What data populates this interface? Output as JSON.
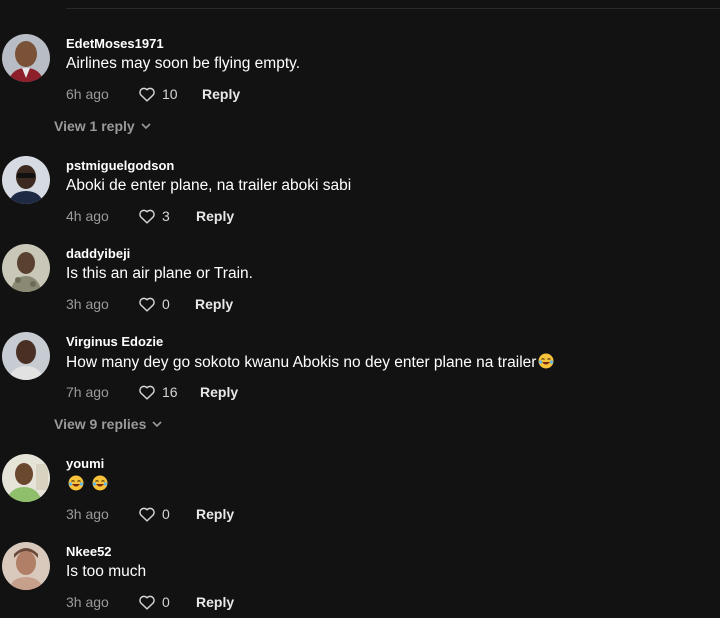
{
  "comments": [
    {
      "username": "EdetMoses1971",
      "text": "Airlines may soon be flying empty.",
      "time": "6h ago",
      "likes": "10",
      "reply_label": "Reply"
    },
    {
      "username": "pstmiguelgodson",
      "text": "Aboki de enter plane, na trailer aboki sabi",
      "time": "4h ago",
      "likes": "3",
      "reply_label": "Reply"
    },
    {
      "username": "daddyibeji",
      "text": "Is this an air plane or Train.",
      "time": "3h ago",
      "likes": "0",
      "reply_label": "Reply"
    },
    {
      "username": "Virginus Edozie",
      "text": "How many dey go sokoto kwanu Abokis no dey enter plane na trailer",
      "time": "7h ago",
      "likes": "16",
      "reply_label": "Reply"
    },
    {
      "username": "youmi",
      "text": "",
      "time": "3h ago",
      "likes": "0",
      "reply_label": "Reply"
    },
    {
      "username": "Nkee52",
      "text": "Is too much",
      "time": "3h ago",
      "likes": "0",
      "reply_label": "Reply"
    }
  ],
  "view_replies": [
    "View 1 reply",
    "View 9 replies"
  ],
  "icons": {
    "like": "heart-outline-icon",
    "expand": "chevron-down-icon",
    "emoji": "laughing-tears-emoji"
  },
  "colors": {
    "background": "#121212",
    "text": "#ffffff",
    "muted": "#9a9a9a"
  }
}
